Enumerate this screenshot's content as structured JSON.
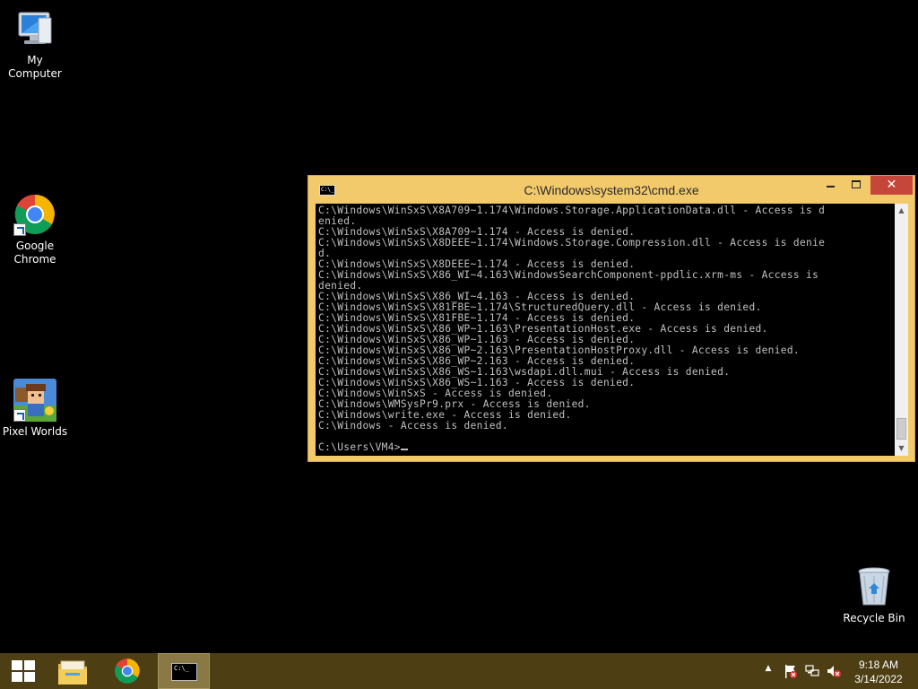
{
  "desktop": {
    "icons": [
      {
        "label": "My Computer",
        "icon": "computer-icon"
      },
      {
        "label": "Google Chrome",
        "icon": "chrome-icon"
      },
      {
        "label": "Pixel Worlds",
        "icon": "pixel-worlds-icon"
      },
      {
        "label": "Recycle Bin",
        "icon": "recycle-bin-icon"
      }
    ]
  },
  "cmd_window": {
    "title": "C:\\Windows\\system32\\cmd.exe",
    "icon": "cmd-icon",
    "lines": [
      "C:\\Windows\\WinSxS\\X8A709~1.174\\Windows.Storage.ApplicationData.dll - Access is d",
      "enied.",
      "C:\\Windows\\WinSxS\\X8A709~1.174 - Access is denied.",
      "C:\\Windows\\WinSxS\\X8DEEE~1.174\\Windows.Storage.Compression.dll - Access is denie",
      "d.",
      "C:\\Windows\\WinSxS\\X8DEEE~1.174 - Access is denied.",
      "C:\\Windows\\WinSxS\\X86_WI~4.163\\WindowsSearchComponent-ppdlic.xrm-ms - Access is",
      "denied.",
      "C:\\Windows\\WinSxS\\X86_WI~4.163 - Access is denied.",
      "C:\\Windows\\WinSxS\\X81FBE~1.174\\StructuredQuery.dll - Access is denied.",
      "C:\\Windows\\WinSxS\\X81FBE~1.174 - Access is denied.",
      "C:\\Windows\\WinSxS\\X86_WP~1.163\\PresentationHost.exe - Access is denied.",
      "C:\\Windows\\WinSxS\\X86_WP~1.163 - Access is denied.",
      "C:\\Windows\\WinSxS\\X86_WP~2.163\\PresentationHostProxy.dll - Access is denied.",
      "C:\\Windows\\WinSxS\\X86_WP~2.163 - Access is denied.",
      "C:\\Windows\\WinSxS\\X86_WS~1.163\\wsdapi.dll.mui - Access is denied.",
      "C:\\Windows\\WinSxS\\X86_WS~1.163 - Access is denied.",
      "C:\\Windows\\WinSxS - Access is denied.",
      "C:\\Windows\\WMSysPr9.prx - Access is denied.",
      "C:\\Windows\\write.exe - Access is denied.",
      "C:\\Windows - Access is denied.",
      ""
    ],
    "prompt": "C:\\Users\\VM4>"
  },
  "taskbar": {
    "items": [
      "start-icon",
      "file-explorer-icon",
      "chrome-icon",
      "cmd-icon"
    ],
    "tray_icons": [
      "show-hidden-icons-icon",
      "action-center-flag-icon",
      "network-icon",
      "volume-muted-icon"
    ],
    "clock_time": "9:18 AM",
    "clock_date": "3/14/2022"
  },
  "colors": {
    "window_frame": "#f2c96b",
    "close_button": "#c7463b",
    "taskbar": "#4d3e13",
    "console_bg": "#000000",
    "console_text": "#c0c0c0"
  }
}
